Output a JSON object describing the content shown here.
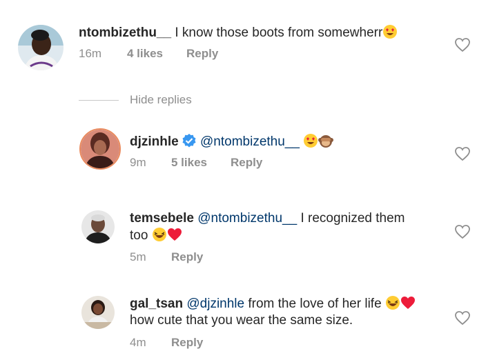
{
  "comments": [
    {
      "username": "ntombizethu__",
      "text": "I know those boots from somewherr",
      "time": "16m",
      "likes": "4 likes",
      "reply": "Reply"
    },
    {
      "username": "djzinhle",
      "mention": "@ntombizethu__",
      "time": "9m",
      "likes": "5 likes",
      "reply": "Reply"
    },
    {
      "username": "temsebele",
      "mention": "@ntombizethu__",
      "text": "I recognized them",
      "text2": "too",
      "time": "5m",
      "reply": "Reply"
    },
    {
      "username": "gal_tsan",
      "mention": "@djzinhle",
      "text": "from the love of her life",
      "text2": "how cute that you wear the same size.",
      "time": "4m",
      "reply": "Reply"
    }
  ],
  "hide_replies": "Hide replies",
  "colors": {
    "text": "#262626",
    "secondary": "#8e8e8e",
    "mention": "#00376b",
    "verified": "#3897f0",
    "heart_red": "#ed1c3a"
  }
}
